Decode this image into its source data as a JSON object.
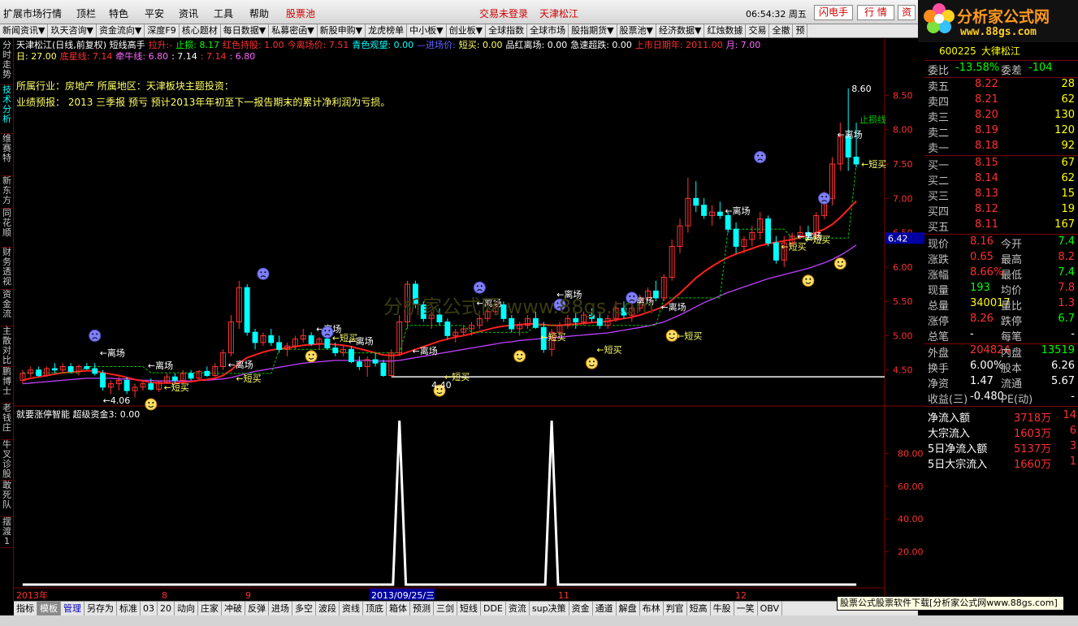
{
  "menubar": {
    "items": [
      "扩展市场行情",
      "顶栏",
      "特色",
      "平安",
      "资讯",
      "工具",
      "帮助",
      "股票池"
    ],
    "status_login": "交易未登录",
    "status_stock": "天津松江",
    "clock": "06:54:32 周五",
    "btn_flash": "闪电手",
    "btn_quote": "行 情",
    "btn_more": "资"
  },
  "toolbar2": [
    "新闻资讯▼",
    "玖天咨询▼",
    "资金流向▼",
    "深度F9",
    "核心题材",
    "每日数据▼",
    "私募密函▼",
    "新股申购▼",
    "龙虎榜单",
    "中小板▼",
    "创业板▼",
    "全球指数",
    "全球市场",
    "股指期货▼",
    "股票池▼",
    "经济数据▼",
    "红烛数據",
    "交易",
    "全撤",
    "预"
  ],
  "logo": {
    "brand": "分析家公式网",
    "url": "www.88gs.com"
  },
  "leftnav": [
    "分时走势",
    "技术分析",
    "维赛特",
    "新东方",
    "同花顺",
    "财务透视",
    "资金流",
    "主散对比",
    "鹏博士",
    "老钱庄",
    "牛叉诊股",
    "敢死队",
    "摆渡1"
  ],
  "info": {
    "line1": [
      {
        "t": "天津松江(日线,前复权) 短线高手",
        "c": "#ffffff"
      },
      {
        "t": "拉升:-",
        "c": "#ff3030"
      },
      {
        "t": "止损: 8.17",
        "c": "#00ff00"
      },
      {
        "t": "红色持股: 1.00",
        "c": "#ff3030"
      },
      {
        "t": "今离场价: 7.51",
        "c": "#ff3030"
      },
      {
        "t": "青色观望: 0.00",
        "c": "#00ffff"
      },
      {
        "t": "—进场价:",
        "c": "#6060ff"
      },
      {
        "t": "短买: 0.00",
        "c": "#ffff66"
      },
      {
        "t": "品红离场: 0.00",
        "c": "#ffffff"
      },
      {
        "t": "急速超跌: 0.00",
        "c": "#ffffff"
      },
      {
        "t": "上市日期年: 2011.00",
        "c": "#ff3030"
      },
      {
        "t": "月: 7.00",
        "c": "#ff66ff"
      }
    ],
    "line2": [
      {
        "t": "日: 27.00",
        "c": "#ffff66"
      },
      {
        "t": "底星线: 7.14",
        "c": "#ff3030"
      },
      {
        "t": "牵牛线: 6.80",
        "c": "#ff66ff"
      },
      {
        "t": ": 7.14",
        "c": "#ffffff"
      },
      {
        "t": ": 7.14",
        "c": "#ff3030"
      },
      {
        "t": ": 6.80",
        "c": "#ff66ff"
      }
    ],
    "industry": "所属行业：房地产   所属地区：天津板块主题投资：",
    "forecast": "业绩预报：  2013 三季报 预亏 预计2013年年初至下一报告期末的累计净利润为亏损。"
  },
  "watermark": "分析家公式网 www.88gs.com",
  "colors": {
    "up": "#ff3232",
    "down": "#00ffff",
    "ma1": "#ff2020",
    "ma2": "#c040ff",
    "stop": "#00c800",
    "axis": "#800000",
    "label": "#ff3030"
  },
  "chart_data": [
    {
      "type": "candlestick",
      "title": "天津松江(日线,前复权) 短线高手",
      "ylim": [
        4.0,
        8.8
      ],
      "yticks": [
        "8.50",
        "8.00",
        "7.50",
        "7.00",
        "6.50",
        "6.00",
        "5.50",
        "5.00",
        "4.50"
      ],
      "current_price_label": "6.42",
      "annotations": [
        "8.60",
        "4.06",
        "4.40",
        "止损线",
        "离场",
        "短买"
      ],
      "xlabels": [
        "2013年",
        "8",
        "9",
        "2013/09/25/三",
        "11",
        "12"
      ],
      "candles": [
        [
          4.35,
          4.5,
          4.3,
          4.45
        ],
        [
          4.45,
          4.55,
          4.4,
          4.5
        ],
        [
          4.5,
          4.55,
          4.4,
          4.42
        ],
        [
          4.42,
          4.55,
          4.4,
          4.52
        ],
        [
          4.52,
          4.6,
          4.45,
          4.5
        ],
        [
          4.5,
          4.6,
          4.45,
          4.55
        ],
        [
          4.55,
          4.6,
          4.45,
          4.48
        ],
        [
          4.48,
          4.58,
          4.42,
          4.55
        ],
        [
          4.55,
          4.6,
          4.5,
          4.52
        ],
        [
          4.52,
          4.6,
          4.42,
          4.45
        ],
        [
          4.45,
          4.5,
          4.2,
          4.25
        ],
        [
          4.25,
          4.35,
          4.15,
          4.3
        ],
        [
          4.3,
          4.4,
          4.2,
          4.35
        ],
        [
          4.35,
          4.4,
          4.15,
          4.2
        ],
        [
          4.2,
          4.3,
          4.1,
          4.25
        ],
        [
          4.25,
          4.35,
          4.2,
          4.3
        ],
        [
          4.3,
          4.38,
          4.2,
          4.22
        ],
        [
          4.22,
          4.35,
          4.18,
          4.32
        ],
        [
          4.32,
          4.45,
          4.3,
          4.4
        ],
        [
          4.4,
          4.45,
          4.3,
          4.35
        ],
        [
          4.35,
          4.5,
          4.3,
          4.45
        ],
        [
          4.45,
          4.5,
          4.35,
          4.38
        ],
        [
          4.38,
          4.5,
          4.35,
          4.48
        ],
        [
          4.48,
          4.55,
          4.4,
          4.42
        ],
        [
          4.42,
          4.6,
          4.4,
          4.55
        ],
        [
          4.55,
          4.8,
          4.5,
          4.75
        ],
        [
          4.75,
          5.3,
          4.7,
          5.2
        ],
        [
          5.2,
          5.8,
          5.1,
          5.7
        ],
        [
          5.7,
          5.75,
          5.0,
          5.05
        ],
        [
          5.05,
          5.1,
          4.8,
          4.9
        ],
        [
          4.9,
          5.05,
          4.85,
          5.0
        ],
        [
          5.0,
          5.1,
          4.85,
          4.9
        ],
        [
          4.9,
          5.0,
          4.75,
          4.8
        ],
        [
          4.8,
          4.9,
          4.7,
          4.85
        ],
        [
          4.85,
          5.0,
          4.8,
          4.95
        ],
        [
          4.95,
          5.1,
          4.9,
          5.0
        ],
        [
          5.0,
          5.05,
          4.85,
          4.88
        ],
        [
          4.88,
          4.98,
          4.8,
          4.95
        ],
        [
          4.95,
          5.0,
          4.8,
          4.82
        ],
        [
          4.82,
          4.9,
          4.7,
          4.75
        ],
        [
          4.75,
          4.85,
          4.7,
          4.8
        ],
        [
          4.8,
          4.85,
          4.6,
          4.62
        ],
        [
          4.62,
          4.7,
          4.5,
          4.55
        ],
        [
          4.55,
          4.7,
          4.4,
          4.65
        ],
        [
          4.65,
          4.75,
          4.55,
          4.6
        ],
        [
          4.6,
          4.65,
          4.4,
          4.42
        ],
        [
          4.42,
          4.8,
          4.4,
          4.75
        ],
        [
          4.75,
          5.3,
          4.7,
          5.2
        ],
        [
          5.2,
          5.8,
          5.1,
          5.75
        ],
        [
          5.75,
          5.8,
          5.4,
          5.45
        ],
        [
          5.45,
          5.5,
          5.2,
          5.25
        ],
        [
          5.25,
          5.35,
          5.1,
          5.3
        ],
        [
          5.3,
          5.4,
          5.15,
          5.2
        ],
        [
          5.2,
          5.25,
          4.95,
          5.0
        ],
        [
          5.0,
          5.1,
          4.9,
          5.05
        ],
        [
          5.05,
          5.15,
          5.0,
          5.1
        ],
        [
          5.1,
          5.2,
          5.0,
          5.15
        ],
        [
          5.15,
          5.3,
          5.1,
          5.25
        ],
        [
          5.25,
          5.4,
          5.2,
          5.35
        ],
        [
          5.35,
          5.5,
          5.3,
          5.45
        ],
        [
          5.45,
          5.5,
          5.2,
          5.25
        ],
        [
          5.25,
          5.3,
          5.05,
          5.1
        ],
        [
          5.1,
          5.2,
          5.0,
          5.15
        ],
        [
          5.15,
          5.3,
          5.1,
          5.25
        ],
        [
          5.25,
          5.35,
          5.1,
          5.12
        ],
        [
          5.12,
          5.2,
          4.75,
          4.8
        ],
        [
          4.8,
          5.1,
          4.7,
          5.05
        ],
        [
          5.05,
          5.2,
          5.0,
          5.15
        ],
        [
          5.15,
          5.3,
          5.1,
          5.25
        ],
        [
          5.25,
          5.35,
          5.1,
          5.2
        ],
        [
          5.2,
          5.35,
          5.15,
          5.3
        ],
        [
          5.3,
          5.4,
          5.2,
          5.25
        ],
        [
          5.25,
          5.35,
          5.1,
          5.15
        ],
        [
          5.15,
          5.3,
          5.1,
          5.25
        ],
        [
          5.25,
          5.5,
          5.2,
          5.4
        ],
        [
          5.4,
          5.5,
          5.25,
          5.3
        ],
        [
          5.3,
          5.45,
          5.2,
          5.4
        ],
        [
          5.4,
          5.6,
          5.35,
          5.55
        ],
        [
          5.55,
          5.7,
          5.5,
          5.65
        ],
        [
          5.65,
          5.8,
          5.5,
          5.55
        ],
        [
          5.55,
          5.9,
          5.5,
          5.85
        ],
        [
          5.85,
          6.4,
          5.8,
          6.3
        ],
        [
          6.3,
          6.7,
          6.2,
          6.6
        ],
        [
          6.6,
          7.3,
          6.5,
          7.0
        ],
        [
          7.0,
          7.25,
          6.8,
          6.9
        ],
        [
          6.9,
          7.0,
          6.7,
          6.75
        ],
        [
          6.75,
          6.9,
          6.6,
          6.8
        ],
        [
          6.8,
          6.95,
          6.7,
          6.75
        ],
        [
          6.75,
          6.8,
          6.5,
          6.55
        ],
        [
          6.55,
          6.65,
          6.2,
          6.3
        ],
        [
          6.3,
          6.45,
          6.2,
          6.4
        ],
        [
          6.4,
          6.6,
          6.3,
          6.5
        ],
        [
          6.5,
          6.8,
          6.4,
          6.7
        ],
        [
          6.7,
          6.75,
          6.3,
          6.35
        ],
        [
          6.35,
          6.45,
          6.05,
          6.1
        ],
        [
          6.1,
          6.45,
          6.0,
          6.35
        ],
        [
          6.35,
          6.5,
          6.3,
          6.45
        ],
        [
          6.45,
          6.6,
          6.4,
          6.5
        ],
        [
          6.5,
          6.6,
          6.4,
          6.45
        ],
        [
          6.45,
          6.8,
          6.4,
          6.75
        ],
        [
          6.75,
          7.1,
          6.7,
          7.0
        ],
        [
          7.0,
          7.6,
          6.9,
          7.5
        ],
        [
          7.5,
          8.1,
          7.4,
          7.9
        ],
        [
          7.9,
          8.6,
          7.4,
          7.6
        ],
        [
          7.6,
          8.1,
          7.45,
          7.5
        ]
      ],
      "ma_fast": [
        4.35,
        4.38,
        4.4,
        4.42,
        4.44,
        4.46,
        4.47,
        4.48,
        4.49,
        4.49,
        4.46,
        4.44,
        4.42,
        4.39,
        4.36,
        4.34,
        4.32,
        4.31,
        4.31,
        4.31,
        4.32,
        4.33,
        4.35,
        4.36,
        4.38,
        4.42,
        4.5,
        4.6,
        4.68,
        4.72,
        4.76,
        4.79,
        4.81,
        4.82,
        4.84,
        4.86,
        4.87,
        4.88,
        4.88,
        4.87,
        4.86,
        4.84,
        4.81,
        4.78,
        4.75,
        4.72,
        4.71,
        4.72,
        4.76,
        4.8,
        4.84,
        4.88,
        4.92,
        4.95,
        4.98,
        5.0,
        5.03,
        5.06,
        5.09,
        5.12,
        5.14,
        5.15,
        5.16,
        5.17,
        5.17,
        5.16,
        5.15,
        5.15,
        5.16,
        5.17,
        5.18,
        5.19,
        5.2,
        5.21,
        5.23,
        5.25,
        5.27,
        5.3,
        5.34,
        5.38,
        5.43,
        5.52,
        5.62,
        5.73,
        5.84,
        5.93,
        6.01,
        6.08,
        6.14,
        6.19,
        6.23,
        6.27,
        6.31,
        6.34,
        6.36,
        6.38,
        6.4,
        6.43,
        6.46,
        6.5,
        6.55,
        6.62,
        6.72,
        6.84,
        6.96
      ],
      "ma_slow": [
        4.3,
        4.31,
        4.32,
        4.33,
        4.34,
        4.35,
        4.36,
        4.37,
        4.38,
        4.38,
        4.38,
        4.38,
        4.37,
        4.37,
        4.36,
        4.35,
        4.35,
        4.34,
        4.34,
        4.34,
        4.34,
        4.34,
        4.35,
        4.35,
        4.36,
        4.37,
        4.39,
        4.42,
        4.45,
        4.48,
        4.5,
        4.52,
        4.54,
        4.56,
        4.58,
        4.6,
        4.61,
        4.62,
        4.63,
        4.64,
        4.64,
        4.64,
        4.64,
        4.64,
        4.63,
        4.63,
        4.63,
        4.64,
        4.66,
        4.68,
        4.7,
        4.72,
        4.74,
        4.76,
        4.78,
        4.8,
        4.82,
        4.84,
        4.86,
        4.88,
        4.9,
        4.91,
        4.93,
        4.94,
        4.95,
        4.96,
        4.97,
        4.98,
        4.99,
        5.0,
        5.01,
        5.02,
        5.03,
        5.04,
        5.06,
        5.08,
        5.1,
        5.12,
        5.14,
        5.17,
        5.2,
        5.25,
        5.3,
        5.36,
        5.42,
        5.48,
        5.53,
        5.58,
        5.63,
        5.67,
        5.71,
        5.75,
        5.79,
        5.83,
        5.86,
        5.89,
        5.92,
        5.95,
        5.98,
        6.02,
        6.06,
        6.11,
        6.17,
        6.24,
        6.32
      ]
    },
    {
      "type": "line",
      "title": "就要涨停智能 超级资金3: 0.00",
      "ylim": [
        0,
        100
      ],
      "yticks": [
        "80.00",
        "60.00",
        "40.00",
        "20.00"
      ],
      "spikes": [
        {
          "index": 47,
          "value": 100
        },
        {
          "index": 66,
          "value": 100
        }
      ],
      "series": [
        {
          "name": "超级资金3",
          "count": 105,
          "baseline": 0
        }
      ]
    }
  ],
  "quote": {
    "code": "600225",
    "name": "大律松江",
    "ratio": [
      {
        "l": "委比",
        "v": "-13.58%",
        "c": "#00ff00"
      },
      {
        "l": "委差",
        "v": "-104",
        "c": "#00ff00"
      }
    ],
    "sell": [
      {
        "l": "卖五",
        "p": "8.22",
        "q": "28"
      },
      {
        "l": "卖四",
        "p": "8.21",
        "q": "62"
      },
      {
        "l": "卖三",
        "p": "8.20",
        "q": "130"
      },
      {
        "l": "卖二",
        "p": "8.19",
        "q": "120"
      },
      {
        "l": "卖一",
        "p": "8.18",
        "q": "92"
      }
    ],
    "buy": [
      {
        "l": "买一",
        "p": "8.15",
        "q": "67"
      },
      {
        "l": "买二",
        "p": "8.14",
        "q": "62"
      },
      {
        "l": "买三",
        "p": "8.13",
        "q": "15"
      },
      {
        "l": "买四",
        "p": "8.12",
        "q": "19"
      },
      {
        "l": "买五",
        "p": "8.11",
        "q": "167"
      }
    ],
    "stats": [
      [
        {
          "l": "现价",
          "v": "8.16",
          "c": "#ff3030"
        },
        {
          "l": "今开",
          "v": "7.4",
          "c": "#00ff00"
        }
      ],
      [
        {
          "l": "涨跌",
          "v": "0.65",
          "c": "#ff3030"
        },
        {
          "l": "最高",
          "v": "8.2",
          "c": "#ff3030"
        }
      ],
      [
        {
          "l": "涨幅",
          "v": "8.66%",
          "c": "#ff3030"
        },
        {
          "l": "最低",
          "v": "7.4",
          "c": "#00ff00"
        }
      ],
      [
        {
          "l": "现量",
          "v": "193",
          "c": "#00ff00"
        },
        {
          "l": "均价",
          "v": "7.8",
          "c": "#ff3030"
        }
      ],
      [
        {
          "l": "总量",
          "v": "340017",
          "c": "#ffff00"
        },
        {
          "l": "量比",
          "v": "1.3",
          "c": "#ff3030"
        }
      ],
      [
        {
          "l": "涨停",
          "v": "8.26",
          "c": "#ff3030"
        },
        {
          "l": "跌停",
          "v": "6.7",
          "c": "#00ff00"
        }
      ],
      [
        {
          "l": "总笔",
          "v": "-",
          "c": "#ffffff"
        },
        {
          "l": "每笔",
          "v": "-",
          "c": "#ffffff"
        }
      ],
      [
        {
          "l": "外盘",
          "v": "204824",
          "c": "#ff3030"
        },
        {
          "l": "内盘",
          "v": "13519",
          "c": "#00ff00"
        }
      ],
      [
        {
          "l": "换手",
          "v": "6.00%",
          "c": "#ffffff"
        },
        {
          "l": "股本",
          "v": "6.26",
          "c": "#ffffff"
        }
      ],
      [
        {
          "l": "净资",
          "v": "1.47",
          "c": "#ffffff"
        },
        {
          "l": "流通",
          "v": "5.67",
          "c": "#ffffff"
        }
      ],
      [
        {
          "l": "收益(三)",
          "v": "-0.480",
          "c": "#ffffff"
        },
        {
          "l": "PE(动)",
          "v": "-",
          "c": "#ffffff"
        }
      ]
    ],
    "flow": [
      {
        "l": "净流入额",
        "v": "3718万",
        "v2": "14"
      },
      {
        "l": "大宗流入",
        "v": "1603万",
        "v2": "6"
      },
      {
        "l": "5日净流入额",
        "v": "5137万",
        "v2": "3"
      },
      {
        "l": "5日大宗流入",
        "v": "1660万",
        "v2": "1"
      }
    ]
  },
  "tabbar": [
    "指标",
    "模板",
    "管理",
    "另存为",
    "标准",
    "03",
    "20",
    "动向",
    "庄家",
    "冲破",
    "反弹",
    "进场",
    "多空",
    "波段",
    "资线",
    "顶底",
    "箱体",
    "预测",
    "三剑",
    "短线",
    "DDE",
    "资流",
    "sup决策",
    "资金",
    "通道",
    "解盘",
    "布林",
    "判官",
    "短高",
    "牛股",
    "一笑",
    "OBV"
  ],
  "adbanner": "股票公式股票软件下载[分析家公式网www.88gs.com]"
}
